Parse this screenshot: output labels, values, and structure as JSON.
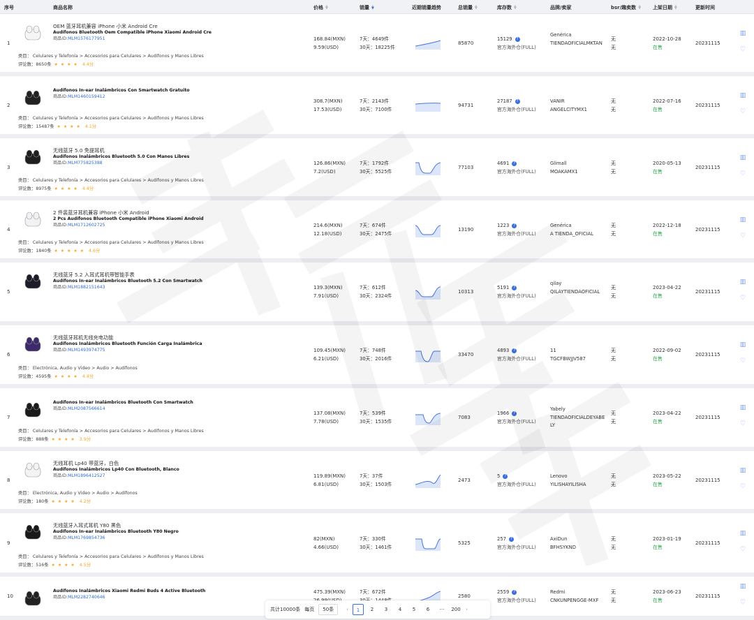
{
  "headers": {
    "idx": "序号",
    "name": "商品名称",
    "price": "价格",
    "sales": "销量",
    "trend": "近期销量趋势",
    "total": "总销量",
    "stock": "库存数",
    "brand": "品牌/卖家",
    "bsr": "bsr/趣卖数",
    "listed": "上架日期",
    "updated": "更新时间"
  },
  "labels": {
    "cat_prefix": "类目：",
    "reviews_prefix": "评论数：",
    "pid_prefix": "商品ID:",
    "sales7_prefix": "7天：",
    "sales30_prefix": "30天：",
    "warehouse": "官方海外仓(FULL)",
    "onsale": "在售",
    "none": "无"
  },
  "rows": [
    {
      "idx": "1",
      "cn": "OEM 蓝牙耳机兼容 iPhone 小米 Android Cre",
      "es": "Audífonos Bluetooth Oem Compatible iPhone Xiaomi Android Cre",
      "pid": "MLM1576177951",
      "cat": "类目： Celulares y Telefonía > Accesorios para Celulares > Audífonos y Manos Libres",
      "reviews": "评论数：8650条",
      "stars": "★ ★ ★ ★",
      "score": "4.4分",
      "mxn": "168.84(MXN)",
      "usd": "9.59(USD)",
      "s7": "7天：4649件",
      "s30": "30天：18225件",
      "total": "85870",
      "stock": "15129",
      "wh": "官方海外仓(FULL)",
      "brand": "Genérica",
      "seller": "TIENDAOFICIALMKTAN",
      "b1": "无",
      "b2": "无",
      "date": "2022-10-28",
      "status": "在售",
      "upd": "20231115"
    },
    {
      "idx": "2",
      "cn": "",
      "es": "Audífonos In-ear Inalámbricos Con Smartwatch Gratuito",
      "pid": "MLM1460159412",
      "cat": "类目： Celulares y Telefonía > Accesorios para Celulares > Audífonos y Manos Libres",
      "reviews": "评论数：15487条",
      "stars": "★ ★ ★ ★",
      "score": "4.1分",
      "mxn": "308.7(MXN)",
      "usd": "17.53(USD)",
      "s7": "7天：2143件",
      "s30": "30天：7100件",
      "total": "94731",
      "stock": "27187",
      "wh": "官方海外仓(FULL)",
      "brand": "VANIR",
      "seller": "ANGELCITYMX1",
      "b1": "无",
      "b2": "无",
      "date": "2022-07-16",
      "status": "在售",
      "upd": "20231115"
    },
    {
      "idx": "3",
      "cn": "无线蓝牙 5.0 免提耳机",
      "es": "Audífonos Inalámbricos Bluetooth 5.0 Con Manos Libres",
      "pid": "MLM775825388",
      "cat": "类目： Celulares y Telefonía > Accesorios para Celulares > Audífonos y Manos Libres",
      "reviews": "评论数：8975条",
      "stars": "★ ★ ★ ★",
      "score": "4.4分",
      "mxn": "126.86(MXN)",
      "usd": "7.2(USD)",
      "s7": "7天：1792件",
      "s30": "30天：5525件",
      "total": "77103",
      "stock": "4691",
      "wh": "官方海外仓(FULL)",
      "brand": "Glimall",
      "seller": "MOAKAMX1",
      "b1": "无",
      "b2": "无",
      "date": "2020-05-13",
      "status": "在售",
      "upd": "20231115"
    },
    {
      "idx": "4",
      "cn": "2 件装蓝牙耳机兼容 iPhone 小米 Android",
      "es": "2 Pcs Audífonos Bluetooth Compatible iPhone Xiaomi Android",
      "pid": "MLM1712602725",
      "cat": "类目： Celulares y Telefonía > Accesorios para Celulares > Audífonos y Manos Libres",
      "reviews": "评论数：1840条",
      "stars": "★ ★ ★ ★ ★",
      "score": "4.6分",
      "mxn": "214.6(MXN)",
      "usd": "12.18(USD)",
      "s7": "7天：674件",
      "s30": "30天：2475件",
      "total": "13190",
      "stock": "1223",
      "wh": "官方海外仓(FULL)",
      "brand": "Genérica",
      "seller": "A TIENDA_OFICIAL",
      "b1": "无",
      "b2": "无",
      "date": "2022-12-18",
      "status": "在售",
      "upd": "20231115"
    },
    {
      "idx": "5",
      "cn": "无线蓝牙 5.2 入耳式耳机带智能手表",
      "es": "Audífonos In-ear Inalámbricos Bluetooth 5.2 Con Smartwatch",
      "pid": "MLM1882151643",
      "cat": "",
      "reviews": "",
      "stars": "",
      "score": "",
      "mxn": "139.3(MXN)",
      "usd": "7.91(USD)",
      "s7": "7天：612件",
      "s30": "30天：2324件",
      "total": "10313",
      "stock": "5191",
      "wh": "官方海外仓(FULL)",
      "brand": "qilay",
      "seller": "QILAYTIENDAOFICIAL",
      "b1": "无",
      "b2": "无",
      "date": "2023-04-22",
      "status": "在售",
      "upd": "20231115"
    },
    {
      "idx": "6",
      "cn": "无线蓝牙耳机无线充电功能",
      "es": "Audífonos Inalámbricos Bluetooth Función Carga Inalámbrica",
      "pid": "MLM1493974775",
      "cat": "类目： Electrónica, Audio y Video > Audio > Audífonos",
      "reviews": "评论数：4595条",
      "stars": "★ ★ ★ ★",
      "score": "4.4分",
      "mxn": "109.45(MXN)",
      "usd": "6.21(USD)",
      "s7": "7天：748件",
      "s30": "30天：2016件",
      "total": "33470",
      "stock": "4893",
      "wh": "官方海外仓(FULL)",
      "brand": "11",
      "seller": "TGCFBWJJV587",
      "b1": "无",
      "b2": "无",
      "date": "2022-09-02",
      "status": "在售",
      "upd": "20231115"
    },
    {
      "idx": "7",
      "cn": "",
      "es": "Audífonos In-ear Inalámbricos Bluetooth Con Smartwatch",
      "pid": "MLM2087566614",
      "cat": "类目： Celulares y Telefonía > Accesorios para Celulares > Audífonos y Manos Libres",
      "reviews": "评论数：888条",
      "stars": "★ ★ ★ ★",
      "score": "3.9分",
      "mxn": "137.08(MXN)",
      "usd": "7.78(USD)",
      "s7": "7天：539件",
      "s30": "30天：1535件",
      "total": "7083",
      "stock": "1966",
      "wh": "官方海外仓(FULL)",
      "brand": "Yabely",
      "seller": "TIENDAOFICIALDEYABELY",
      "b1": "无",
      "b2": "无",
      "date": "2023-04-22",
      "status": "在售",
      "upd": "20231115"
    },
    {
      "idx": "8",
      "cn": "无线耳机 Lp40 带蓝牙，白色",
      "es": "Audífonos Inalámbricos Lp40 Con Bluetooth, Blanco",
      "pid": "MLM1896412527",
      "cat": "类目： Electrónica, Audio y Video > Audio > Audífonos",
      "reviews": "评论数：180条",
      "stars": "★ ★ ★ ★",
      "score": "4.2分",
      "mxn": "119.89(MXN)",
      "usd": "6.81(USD)",
      "s7": "7天：37件",
      "s30": "30天：1503件",
      "total": "2473",
      "stock": "5",
      "wh": "官方海外仓(FULL)",
      "brand": "Lenovo",
      "seller": "YILISHAYILISHA",
      "b1": "无",
      "b2": "无",
      "date": "2023-05-22",
      "status": "在售",
      "upd": "20231115"
    },
    {
      "idx": "9",
      "cn": "无线蓝牙入耳式耳机 Y80 黑色",
      "es": "Audífonos In-ear Inalámbricos Bluetooth Y80 Negro",
      "pid": "MLM1769854736",
      "cat": "类目： Celulares y Telefonía > Accesorios para Celulares > Audífonos y Manos Libres",
      "reviews": "评论数：516条",
      "stars": "★ ★ ★ ★",
      "score": "4.5分",
      "mxn": "82(MXN)",
      "usd": "4.66(USD)",
      "s7": "7天：330件",
      "s30": "30天：1461件",
      "total": "5325",
      "stock": "257",
      "wh": "官方海外仓(FULL)",
      "brand": "AxiDun",
      "seller": "BFHSYKND",
      "b1": "无",
      "b2": "无",
      "date": "2023-01-19",
      "status": "在售",
      "upd": "20231115"
    },
    {
      "idx": "10",
      "cn": "",
      "es": "Audífonos Inalámbricos Xiaomi Redmi Buds 4 Active Bluetooth",
      "pid": "MLM2282740646",
      "cat": "",
      "reviews": "",
      "stars": "",
      "score": "",
      "mxn": "475.39(MXN)",
      "usd": "26.99(USD)",
      "s7": "7天：672件",
      "s30": "30天：1448件",
      "total": "2580",
      "stock": "2559",
      "wh": "官方海外仓(FULL)",
      "brand": "Redmi",
      "seller": "CNKUNPENGGE-MXF",
      "b1": "无",
      "b2": "无",
      "date": "2023-06-23",
      "status": "在售",
      "upd": "20231115"
    }
  ],
  "pager": {
    "total": "共计10000条",
    "per_page_label": "每页",
    "per_page": "50条",
    "prev": "‹",
    "pages": [
      "1",
      "2",
      "3",
      "4",
      "5",
      "6"
    ],
    "ellipsis": "···",
    "last": "200",
    "next": "›"
  }
}
